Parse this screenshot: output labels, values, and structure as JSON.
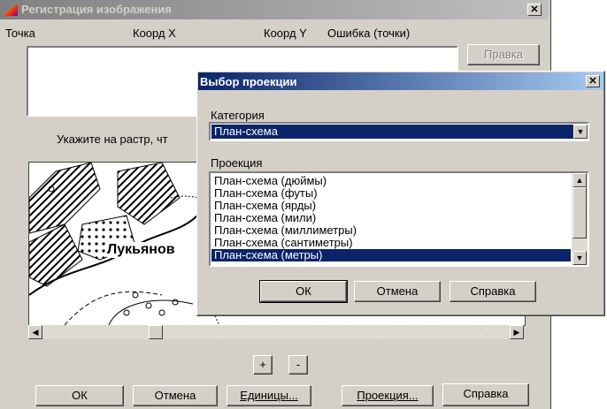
{
  "main_window": {
    "title": "Регистрация изображения",
    "columns": [
      "Точка",
      "Коорд X",
      "Коорд Y",
      "Ошибка (точки)"
    ],
    "help_top_label": "Правка",
    "instruction": "Укажите на растр, чт",
    "map_label": "Лукьянов",
    "zoom_in_label": "+",
    "zoom_out_label": "-",
    "buttons": {
      "ok": "ОК",
      "cancel": "Отмена",
      "units": "Единицы...",
      "projection": "Проекция...",
      "help": "Справка"
    }
  },
  "projection_dialog": {
    "title": "Выбор проекции",
    "category_label": "Категория",
    "category_value": "План-схема",
    "projection_label": "Проекция",
    "projections": [
      "План-схема (дюймы)",
      "План-схема (футы)",
      "План-схема (ярды)",
      "План-схема (мили)",
      "План-схема (миллиметры)",
      "План-схема (сантиметры)",
      "План-схема (метры)"
    ],
    "selected_index": 6,
    "buttons": {
      "ok": "ОК",
      "cancel": "Отмена",
      "help": "Справка"
    }
  },
  "colors": {
    "selection": "#0a246a",
    "dialog_bg": "#d4d0c8"
  }
}
